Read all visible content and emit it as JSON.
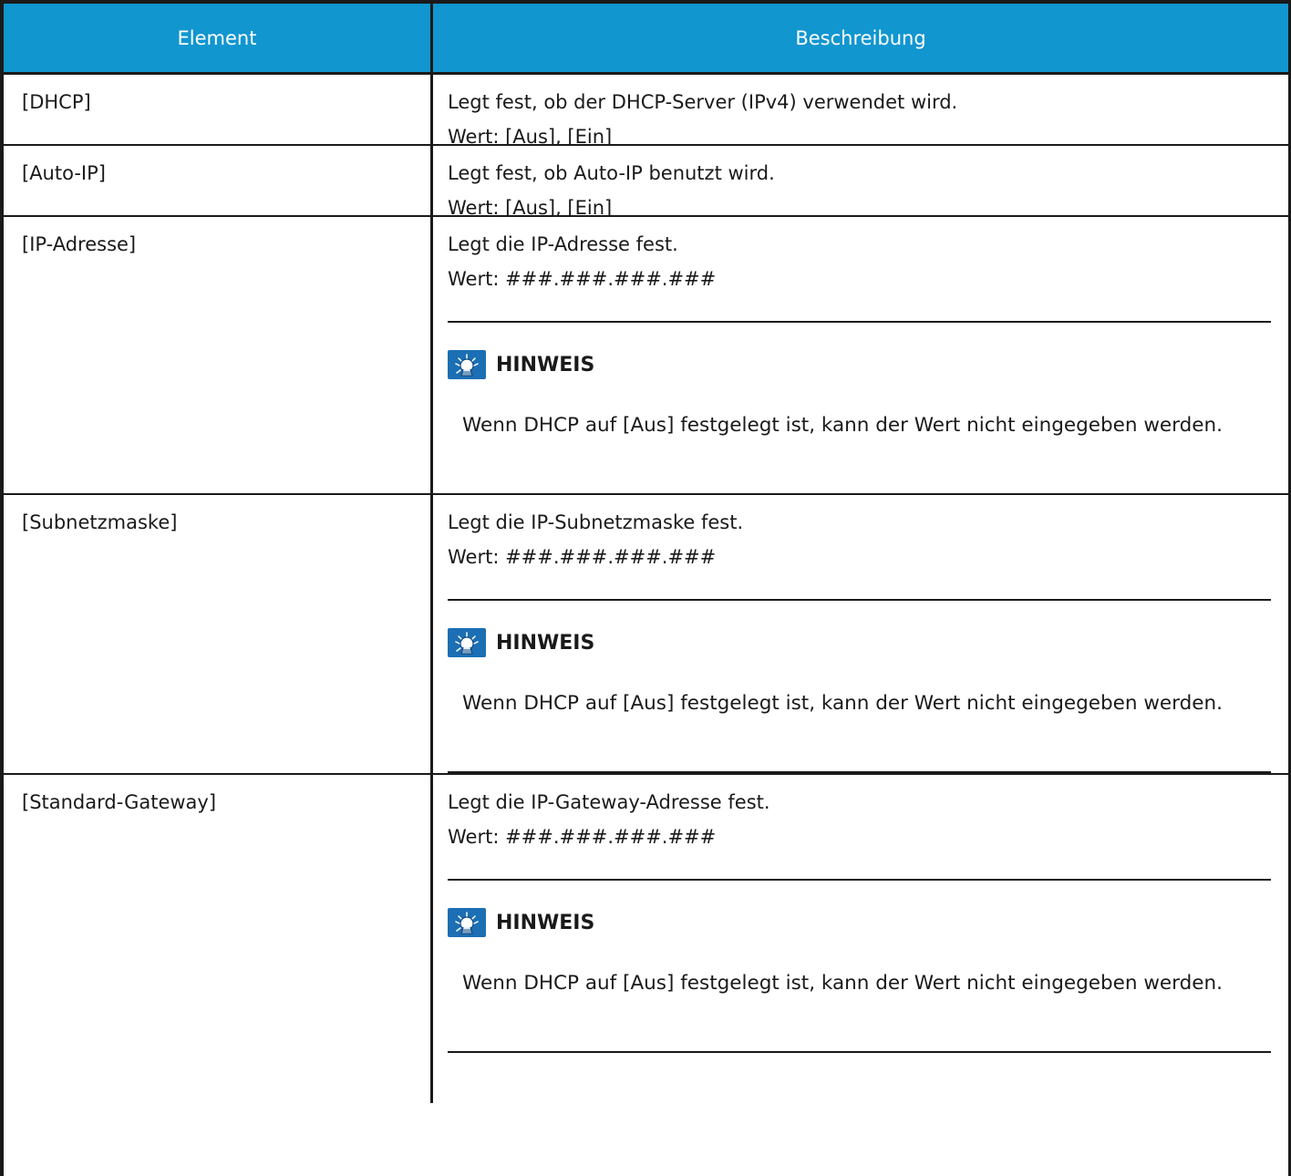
{
  "table": {
    "header": {
      "col1": "Element",
      "col2": "Beschreibung"
    },
    "rows": [
      {
        "element": "[DHCP]",
        "lines": [
          "Legt fest, ob der DHCP-Server (IPv4) verwendet wird.",
          "Wert: [Aus], [Ein]"
        ]
      },
      {
        "element": "[Auto-IP]",
        "lines": [
          "Legt fest, ob Auto-IP benutzt wird.",
          "Wert: [Aus], [Ein]"
        ]
      },
      {
        "element": "[IP-Adresse]",
        "lines": [
          "Legt die IP-Adresse fest.",
          "Wert: ###.###.###.###"
        ],
        "note": {
          "title": "HINWEIS",
          "text": "Wenn DHCP auf [Aus] festgelegt ist, kann der Wert nicht eingegeben werden."
        }
      },
      {
        "element": "[Subnetzmaske]",
        "lines": [
          "Legt die IP-Subnetzmaske fest.",
          "Wert: ###.###.###.###"
        ],
        "note": {
          "title": "HINWEIS",
          "text": "Wenn DHCP auf [Aus] festgelegt ist, kann der Wert nicht eingegeben werden."
        }
      },
      {
        "element": "[Standard-Gateway]",
        "lines": [
          "Legt die IP-Gateway-Adresse fest.",
          "Wert: ###.###.###.###"
        ],
        "note": {
          "title": "HINWEIS",
          "text": "Wenn DHCP auf [Aus] festgelegt ist, kann der Wert nicht eingegeben werden."
        }
      }
    ]
  },
  "icons": {
    "note_icon": "lightbulb-hint-icon"
  },
  "colors": {
    "header_bg": "#1196d0",
    "header_text": "#ffffff",
    "icon_bg": "#1c6fb4"
  }
}
